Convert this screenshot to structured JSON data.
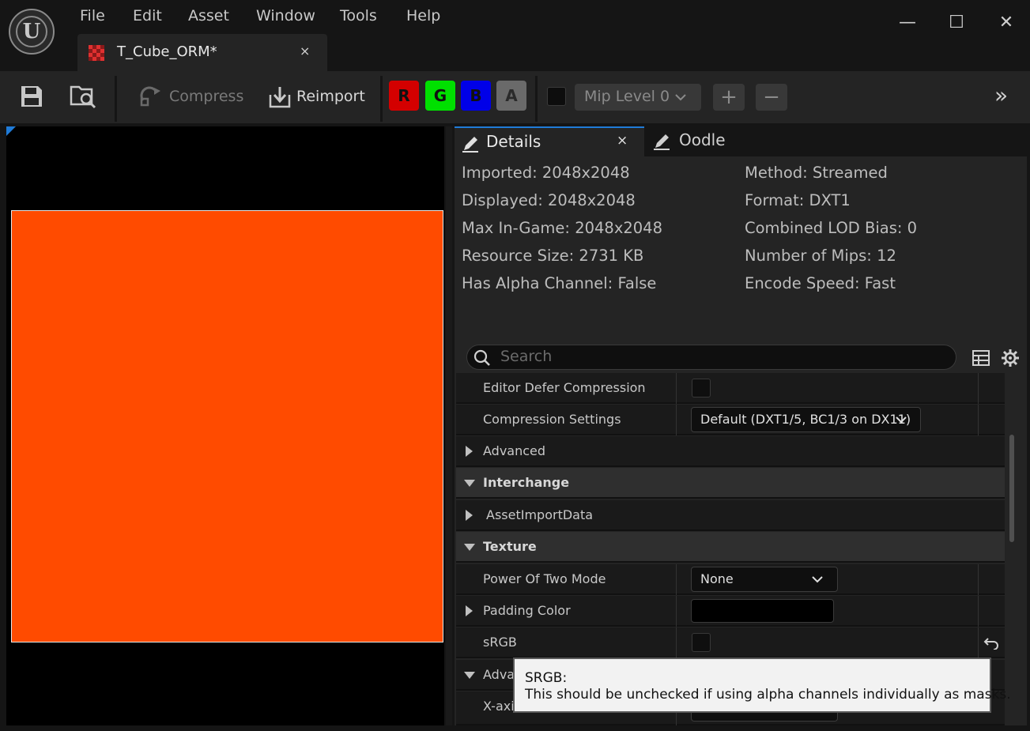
{
  "menu": {
    "items": [
      "File",
      "Edit",
      "Asset",
      "Window",
      "Tools",
      "Help"
    ]
  },
  "logo": {
    "glyph": "U"
  },
  "document_tab": {
    "title": "T_Cube_ORM*",
    "close_glyph": "×"
  },
  "window_controls": {
    "minimize": "—",
    "maximize": "☐",
    "close": "✕"
  },
  "toolbar": {
    "compress_label": "Compress",
    "reimport_label": "Reimport",
    "channels": [
      {
        "label": "R",
        "color": "#d40000"
      },
      {
        "label": "G",
        "color": "#00e000"
      },
      {
        "label": "B",
        "color": "#0000e8"
      },
      {
        "label": "A",
        "color": "#6a6a6a"
      }
    ],
    "mip_level": "Mip Level 0",
    "plus": "+",
    "minus": "−",
    "overflow": "»"
  },
  "viewport": {
    "texture_color": "#ff4b00"
  },
  "panel": {
    "tabs": [
      {
        "label": "Details",
        "close_glyph": "×"
      },
      {
        "label": "Oodle"
      }
    ],
    "info_left": [
      "Imported: 2048x2048",
      "Displayed: 2048x2048",
      "Max In-Game: 2048x2048",
      "Resource Size: 2731 KB",
      "Has Alpha Channel: False"
    ],
    "info_right": [
      "Method: Streamed",
      "Format: DXT1",
      "Combined LOD Bias: 0",
      "Number of Mips: 12",
      "Encode Speed: Fast"
    ],
    "search_placeholder": "Search",
    "rows": {
      "editor_defer_compression": "Editor Defer Compression",
      "compression_settings": "Compression Settings",
      "compression_settings_value": "Default (DXT1/5, BC1/3 on DX11)",
      "advanced": "Advanced",
      "interchange": "Interchange",
      "asset_import_data": "AssetImportData",
      "texture": "Texture",
      "power_of_two_mode": "Power Of Two Mode",
      "power_of_two_value": "None",
      "padding_color": "Padding Color",
      "srgb": "sRGB",
      "advanced2": "Adva",
      "x_axis": "X-axi"
    }
  },
  "tooltip": {
    "title": "SRGB:",
    "body": "This should be unchecked if using alpha channels individually as masks."
  }
}
